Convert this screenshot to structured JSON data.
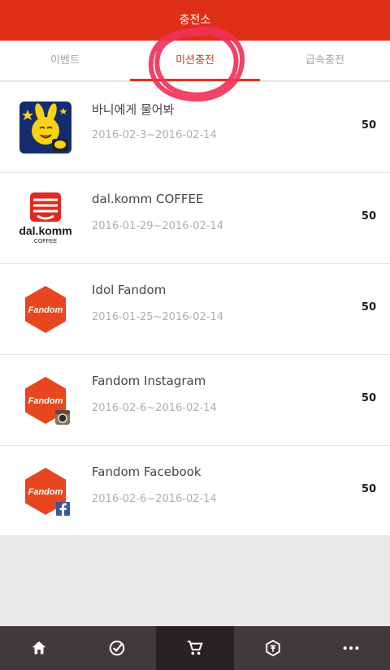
{
  "header": {
    "title": "충전소"
  },
  "tabs": [
    {
      "label": "이벤트"
    },
    {
      "label": "미션충전"
    },
    {
      "label": "급속충전"
    }
  ],
  "missions": [
    {
      "name": "바니에게 물어봐",
      "date": "2016-02-3~2016-02-14",
      "points": "50",
      "icon": "bunny-app-icon"
    },
    {
      "name": "dal.komm COFFEE",
      "date": "2016-01-29~2016-02-14",
      "points": "50",
      "icon": "dalkomm-coffee-logo"
    },
    {
      "name": "Idol Fandom",
      "date": "2016-01-25~2016-02-14",
      "points": "50",
      "icon": "fandom-logo"
    },
    {
      "name": "Fandom Instagram",
      "date": "2016-02-6~2016-02-14",
      "points": "50",
      "icon": "fandom-instagram-logo"
    },
    {
      "name": "Fandom Facebook",
      "date": "2016-02-6~2016-02-14",
      "points": "50",
      "icon": "fandom-facebook-logo"
    }
  ],
  "logo_text": {
    "dalkomm_brand": "dal.komm",
    "dalkomm_sub": "COFFEE",
    "fandom": "Fandom"
  },
  "bottom_nav": [
    {
      "icon": "home-icon"
    },
    {
      "icon": "check-circle-icon"
    },
    {
      "icon": "cart-icon",
      "active": true
    },
    {
      "icon": "coin-icon"
    },
    {
      "icon": "more-icon"
    }
  ],
  "colors": {
    "accent": "#de2f17",
    "nav_bg": "#3f3b3a",
    "nav_active": "#262322"
  }
}
